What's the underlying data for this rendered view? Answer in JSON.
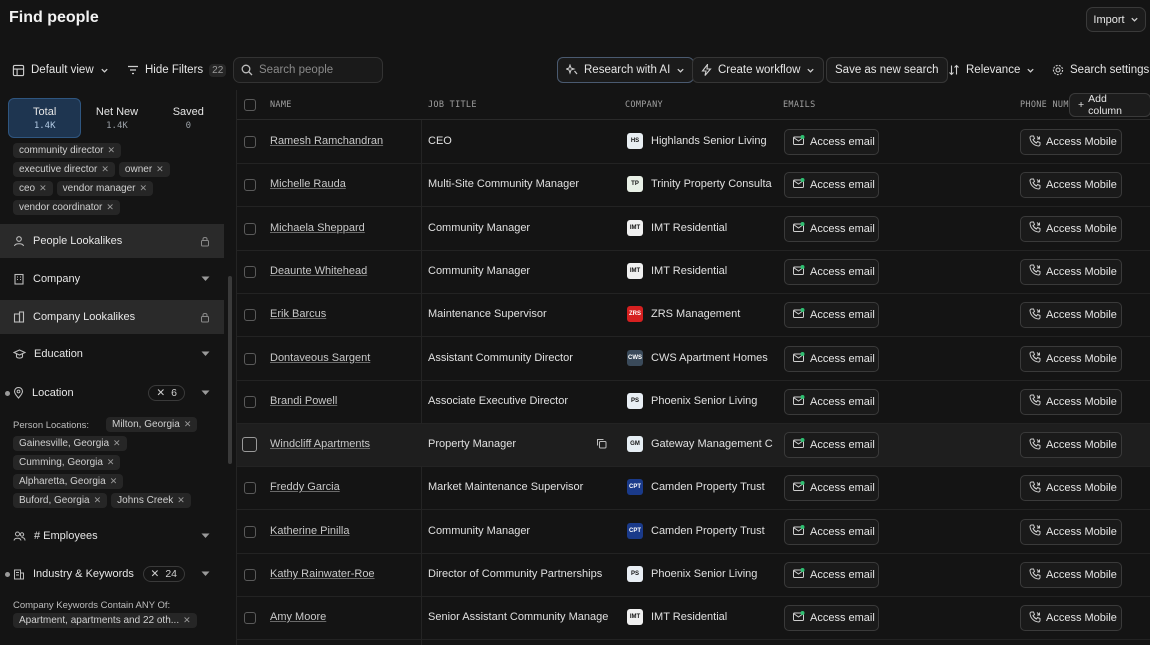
{
  "header": {
    "title": "Find people",
    "import_label": "Import"
  },
  "toolbar": {
    "default_view": "Default view",
    "hide_filters": "Hide Filters",
    "filters_count": "22",
    "search_placeholder": "Search people",
    "research_ai": "Research with AI",
    "create_workflow": "Create workflow",
    "save_search": "Save as new search",
    "relevance": "Relevance",
    "search_settings": "Search settings"
  },
  "sidebar": {
    "tabs": [
      {
        "label": "Total",
        "value": "1.4K"
      },
      {
        "label": "Net New",
        "value": "1.4K"
      },
      {
        "label": "Saved",
        "value": "0"
      }
    ],
    "title_chips": [
      "community director",
      "executive director",
      "owner",
      "ceo",
      "vendor manager",
      "vendor coordinator"
    ],
    "sections": {
      "people_lookalikes": "People Lookalikes",
      "company": "Company",
      "company_lookalikes": "Company Lookalikes",
      "education": "Education",
      "location": "Location",
      "location_count": "6",
      "employees": "# Employees",
      "industry": "Industry & Keywords",
      "industry_count": "24"
    },
    "person_locations_label": "Person Locations:",
    "location_chips": [
      "Milton, Georgia",
      "Gainesville, Georgia",
      "Cumming, Georgia",
      "Alpharetta, Georgia",
      "Buford, Georgia",
      "Johns Creek"
    ],
    "keywords_label": "Company Keywords Contain ANY Of:",
    "keyword_chip": "Apartment, apartments and 22 oth..."
  },
  "table": {
    "columns": {
      "name": "NAME",
      "job_title": "JOB TITLE",
      "company": "COMPANY",
      "emails": "EMAILS",
      "phone": "PHONE NUM"
    },
    "add_column": "Add column",
    "access_email": "Access email",
    "access_mobile": "Access Mobile",
    "rows": [
      {
        "name": "Ramesh Ramchandran",
        "title": "CEO",
        "company": "Highlands Senior Living",
        "logo_color": "#e8eef2",
        "logo_text": "HS"
      },
      {
        "name": "Michelle Rauda",
        "title": "Multi-Site Community Manager",
        "company": "Trinity Property Consulta",
        "logo_color": "#e8f0e6",
        "logo_text": "TP"
      },
      {
        "name": "Michaela Sheppard",
        "title": "Community Manager",
        "company": "IMT Residential",
        "logo_color": "#f0f0f0",
        "logo_text": "IMT"
      },
      {
        "name": "Deaunte Whitehead",
        "title": "Community Manager",
        "company": "IMT Residential",
        "logo_color": "#f0f0f0",
        "logo_text": "IMT"
      },
      {
        "name": "Erik Barcus",
        "title": "Maintenance Supervisor",
        "company": "ZRS Management",
        "logo_color": "#d62020",
        "logo_text": "ZRS"
      },
      {
        "name": "Dontaveous Sargent",
        "title": "Assistant Community Director",
        "company": "CWS Apartment Homes",
        "logo_color": "#3a4a5a",
        "logo_text": "CWS"
      },
      {
        "name": "Brandi Powell",
        "title": "Associate Executive Director",
        "company": "Phoenix Senior Living",
        "logo_color": "#e8eef4",
        "logo_text": "PS"
      },
      {
        "name": "Windcliff Apartments",
        "title": "Property Manager",
        "company": "Gateway Management C",
        "logo_color": "#e6eef4",
        "logo_text": "GM"
      },
      {
        "name": "Freddy Garcia",
        "title": "Market Maintenance Supervisor",
        "company": "Camden Property Trust",
        "logo_color": "#1a3a8a",
        "logo_text": "CPT"
      },
      {
        "name": "Katherine Pinilla",
        "title": "Community Manager",
        "company": "Camden Property Trust",
        "logo_color": "#1a3a8a",
        "logo_text": "CPT"
      },
      {
        "name": "Kathy Rainwater-Roe",
        "title": "Director of Community Partnerships",
        "company": "Phoenix Senior Living",
        "logo_color": "#e8eef4",
        "logo_text": "PS"
      },
      {
        "name": "Amy Moore",
        "title": "Senior Assistant Community Manager",
        "company": "IMT Residential",
        "logo_color": "#f0f0f0",
        "logo_text": "IMT"
      }
    ]
  }
}
